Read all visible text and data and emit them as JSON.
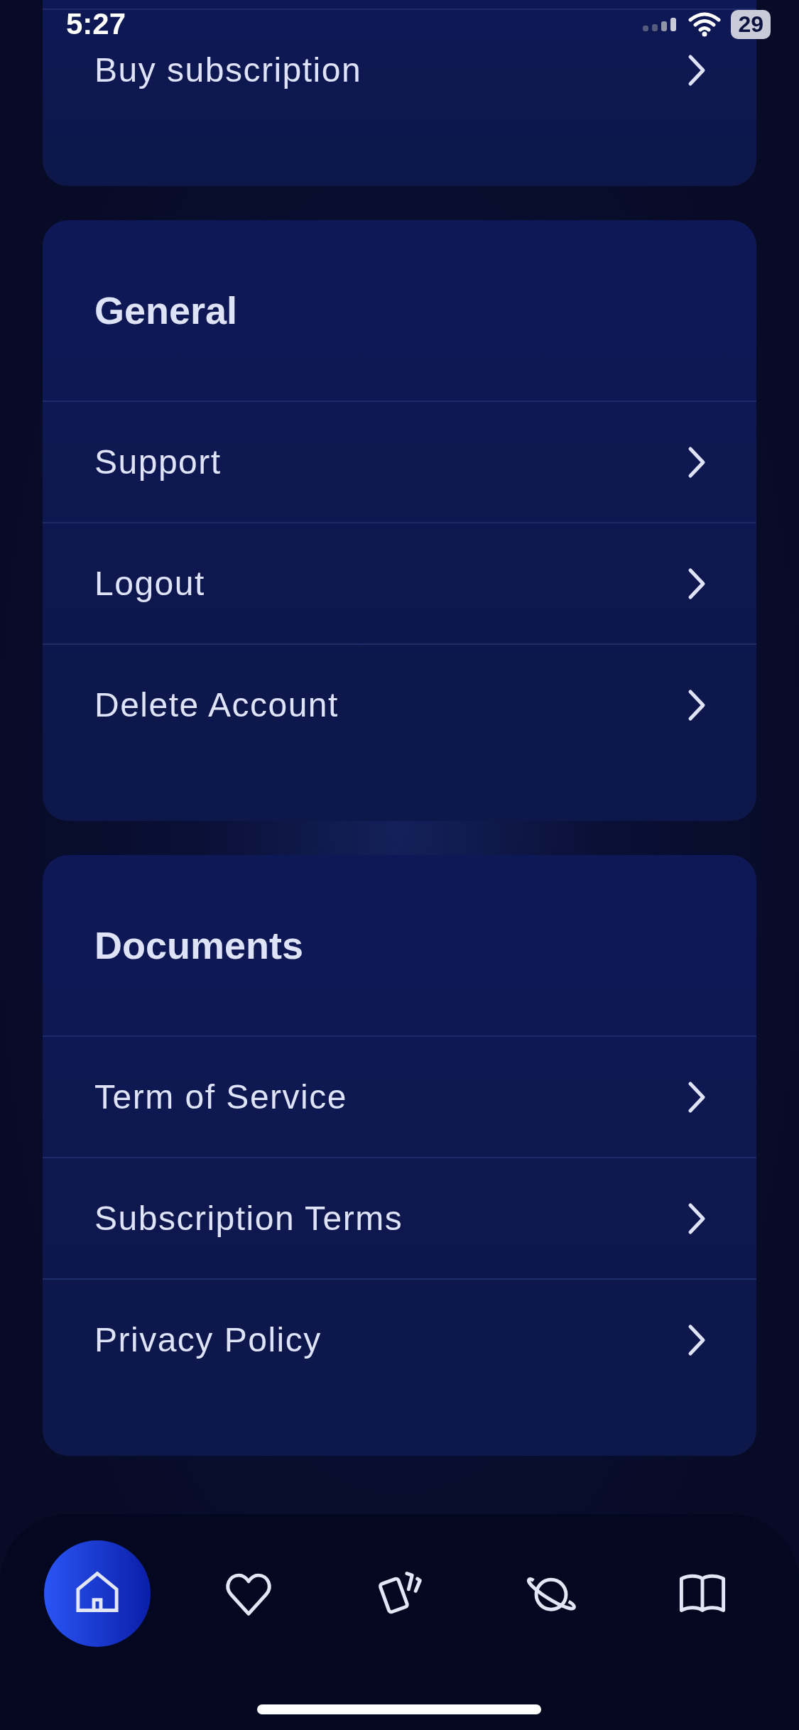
{
  "status_bar": {
    "time": "5:27",
    "battery": "29"
  },
  "sections": [
    {
      "rows": [
        {
          "label": "Buy subscription"
        }
      ]
    },
    {
      "title": "General",
      "rows": [
        {
          "label": "Support"
        },
        {
          "label": "Logout"
        },
        {
          "label": "Delete Account"
        }
      ]
    },
    {
      "title": "Documents",
      "rows": [
        {
          "label": "Term of Service"
        },
        {
          "label": "Subscription Terms"
        },
        {
          "label": "Privacy Policy"
        }
      ]
    }
  ],
  "tab_bar": [
    {
      "kind": "home",
      "selected": true
    },
    {
      "kind": "heart",
      "selected": false
    },
    {
      "kind": "cards",
      "selected": false
    },
    {
      "kind": "planet",
      "selected": false
    },
    {
      "kind": "book",
      "selected": false
    }
  ]
}
